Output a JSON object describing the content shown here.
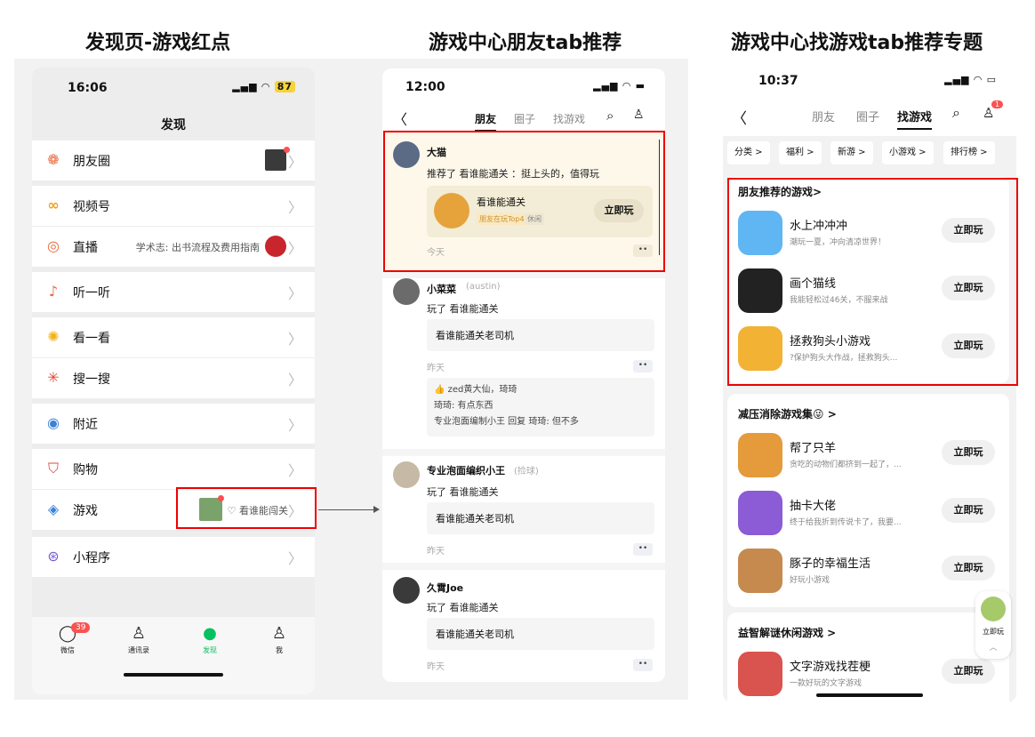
{
  "captions": [
    "发现页-游戏红点",
    "游戏中心朋友tab推荐",
    "游戏中心找游戏tab推荐专题"
  ],
  "phone1": {
    "time": "16:06",
    "status": "87",
    "title": "发现",
    "items": [
      {
        "label": "朋友圈",
        "icon": "moments-icon",
        "glyph": "❁"
      },
      {
        "label": "视频号",
        "icon": "channels-icon",
        "glyph": "∞"
      },
      {
        "label": "直播",
        "icon": "live-icon",
        "glyph": "◎",
        "extra": "学术志: 出书流程及费用指南"
      },
      {
        "label": "听一听",
        "icon": "music-icon",
        "glyph": "♪"
      },
      {
        "label": "看一看",
        "icon": "look-icon",
        "glyph": "✺"
      },
      {
        "label": "搜一搜",
        "icon": "search-icon",
        "glyph": "✳"
      },
      {
        "label": "附近",
        "icon": "nearby-icon",
        "glyph": "◉"
      },
      {
        "label": "购物",
        "icon": "shopping-bag-icon",
        "glyph": "⛉"
      },
      {
        "label": "游戏",
        "icon": "game-icon",
        "glyph": "◈",
        "extra": "♡ 看谁能闯关"
      },
      {
        "label": "小程序",
        "icon": "mini-program-icon",
        "glyph": "⊛"
      }
    ],
    "tabs": [
      {
        "label": "微信",
        "glyph": "💬",
        "badge": "39"
      },
      {
        "label": "通讯录",
        "glyph": "👤"
      },
      {
        "label": "发现",
        "glyph": "🧭"
      },
      {
        "label": "我",
        "glyph": "👤"
      }
    ]
  },
  "phone2": {
    "time": "12:00",
    "tabs": [
      "朋友",
      "圈子",
      "找游戏"
    ],
    "posts": [
      {
        "name": "大猫",
        "action": "推荐了 看谁能通关 ：挺上头的，值得玩",
        "game_title": "看谁能通关",
        "game_tag1": "朋友在玩Top4",
        "game_tag2": "休闲",
        "play": "立即玩",
        "when": "今天"
      },
      {
        "name": "小菜菜",
        "handle": "(austin)",
        "action": "玩了 看谁能通关",
        "bubble": "看谁能通关老司机",
        "when": "昨天",
        "likes": "zed黄大仙，琦琦",
        "comment1": "琦琦: 有点东西",
        "comment2": "专业泡面编制小王 回复 琦琦: 但不多"
      },
      {
        "name": "专业泡面编织小王",
        "handle": "(捡球)",
        "action": "玩了 看谁能通关",
        "bubble": "看谁能通关老司机",
        "when": "昨天"
      },
      {
        "name": "久霄Joe",
        "action": "玩了 看谁能通关",
        "bubble": "看谁能通关老司机",
        "when": "昨天"
      }
    ]
  },
  "phone3": {
    "time": "10:37",
    "tabs": [
      "朋友",
      "圈子",
      "找游戏"
    ],
    "badge": "1",
    "chips": [
      "分类 >",
      "福利 >",
      "新游 >",
      "小游戏 >",
      "排行榜 >"
    ],
    "sections": [
      {
        "title": "朋友推荐的游戏>",
        "games": [
          {
            "name": "水上冲冲冲",
            "desc": "潮玩一夏，冲向清凉世界！",
            "color": "#5fb6f2"
          },
          {
            "name": "画个猫线",
            "desc": "我能轻松过46关，不服来战",
            "color": "#222222"
          },
          {
            "name": "拯救狗头小游戏",
            "desc": "?保护狗头大作战，拯救狗头...",
            "color": "#f2b233"
          }
        ]
      },
      {
        "title": "减压消除游戏集😜 >",
        "games": [
          {
            "name": "帮了只羊",
            "desc": "贪吃的动物们都挤到一起了，...",
            "color": "#e59a3b"
          },
          {
            "name": "抽卡大佬",
            "desc": "终于给我折到传说卡了，我要...",
            "color": "#8c5bd6"
          },
          {
            "name": "豚子的幸福生活",
            "desc": "好玩小游戏",
            "color": "#c68a4f"
          }
        ]
      },
      {
        "title": "益智解谜休闲游戏 >",
        "games": [
          {
            "name": "文字游戏找茬梗",
            "desc": "一款好玩的文字游戏",
            "color": "#d9534f"
          }
        ]
      }
    ],
    "play": "立即玩",
    "float_label": "立即玩"
  },
  "colors": {
    "red_box": "#ee0000",
    "wechat_green": "#07c160",
    "badge_red": "#fa5151"
  }
}
